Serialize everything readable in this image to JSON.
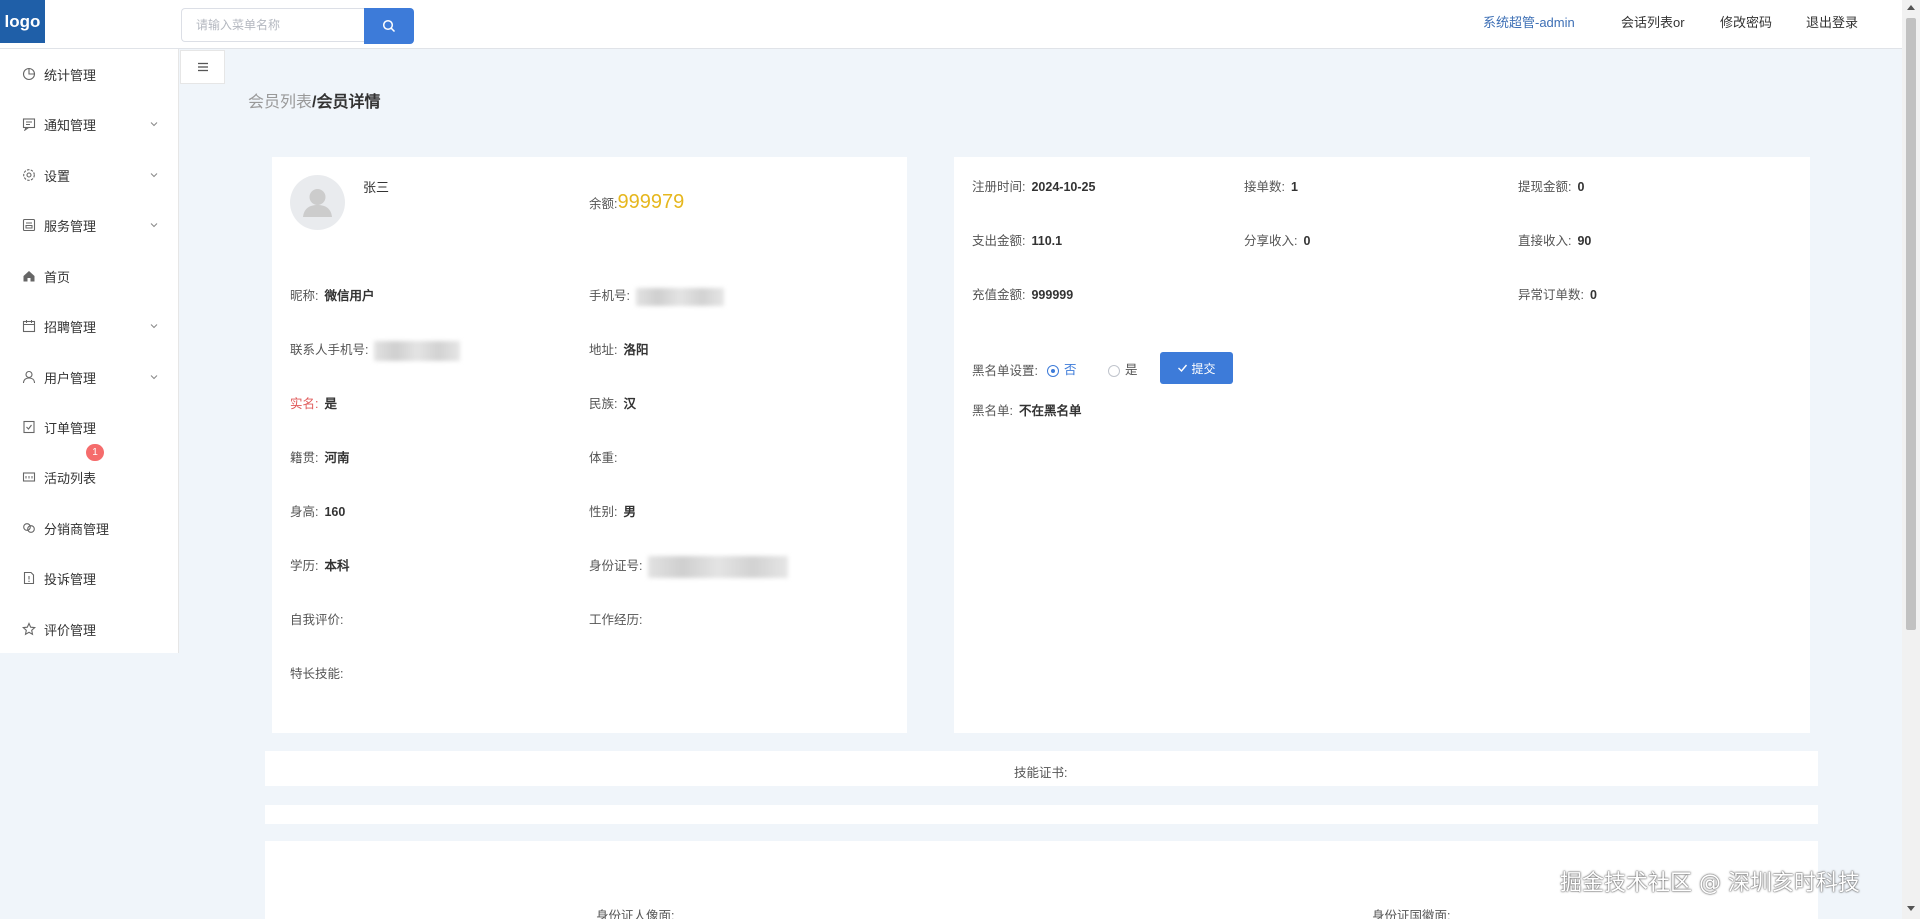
{
  "header": {
    "logo": "logo",
    "search_placeholder": "请输入菜单名称",
    "admin": "系统超管-admin",
    "chat_list": "会话列表or",
    "change_password": "修改密码",
    "logout": "退出登录"
  },
  "sidebar": {
    "items": [
      {
        "label": "统计管理",
        "icon": "pie-chart-icon",
        "arrow": false
      },
      {
        "label": "通知管理",
        "icon": "message-icon",
        "arrow": true
      },
      {
        "label": "设置",
        "icon": "gear-icon",
        "arrow": true
      },
      {
        "label": "服务管理",
        "icon": "service-icon",
        "arrow": true
      },
      {
        "label": "首页",
        "icon": "home-icon",
        "arrow": false
      },
      {
        "label": "招聘管理",
        "icon": "calendar-icon",
        "arrow": true
      },
      {
        "label": "用户管理",
        "icon": "user-icon",
        "arrow": true
      },
      {
        "label": "订单管理",
        "icon": "order-icon",
        "arrow": false
      },
      {
        "label": "活动列表",
        "icon": "activity-icon",
        "arrow": false
      },
      {
        "label": "分销商管理",
        "icon": "distributor-icon",
        "arrow": false
      },
      {
        "label": "投诉管理",
        "icon": "complaint-icon",
        "arrow": false
      },
      {
        "label": "评价管理",
        "icon": "star-icon",
        "arrow": false
      }
    ],
    "badge": "1"
  },
  "breadcrumb": {
    "parent": "会员列表",
    "separator": "/",
    "current": "会员详情"
  },
  "profile": {
    "name": "张三",
    "balance_label": "余额:",
    "balance_value": "999979",
    "nickname_label": "昵称:",
    "nickname": "微信用户",
    "phone_label": "手机号:",
    "contact_phone_label": "联系人手机号:",
    "address_label": "地址:",
    "address": "洛阳",
    "realname_label": "实名:",
    "realname": "是",
    "ethnicity_label": "民族:",
    "ethnicity": "汉",
    "native_label": "籍贯:",
    "native": "河南",
    "weight_label": "体重:",
    "height_label": "身高:",
    "height": "160",
    "gender_label": "性别:",
    "gender": "男",
    "education_label": "学历:",
    "education": "本科",
    "idcard_label": "身份证号:",
    "self_eval_label": "自我评价:",
    "work_exp_label": "工作经历:",
    "skills_label": "特长技能:"
  },
  "stats": {
    "reg_time_label": "注册时间:",
    "reg_time": "2024-10-25",
    "orders_label": "接单数:",
    "orders": "1",
    "withdraw_label": "提现金额:",
    "withdraw": "0",
    "expense_label": "支出金额:",
    "expense": "110.1",
    "share_income_label": "分享收入:",
    "share_income": "0",
    "direct_income_label": "直接收入:",
    "direct_income": "90",
    "recharge_label": "充值金额:",
    "recharge": "999999",
    "abnormal_label": "异常订单数:",
    "abnormal": "0",
    "blacklist_setting_label": "黑名单设置:",
    "option_no": "否",
    "option_yes": "是",
    "submit": "提交",
    "blacklist_label": "黑名单:",
    "blacklist_value": "不在黑名单"
  },
  "sections": {
    "skill_cert": "技能证书:",
    "id_front": "身份证人像面:",
    "id_back": "身份证国徽面:"
  },
  "watermark": "掘金技术社区 @ 深圳亥时科技",
  "colors": {
    "primary": "#3d7bd9",
    "logo_bg": "#1f5fa8",
    "balance": "#e6b71e",
    "badge": "#f56c6c",
    "page_bg": "#f0f5fa"
  }
}
